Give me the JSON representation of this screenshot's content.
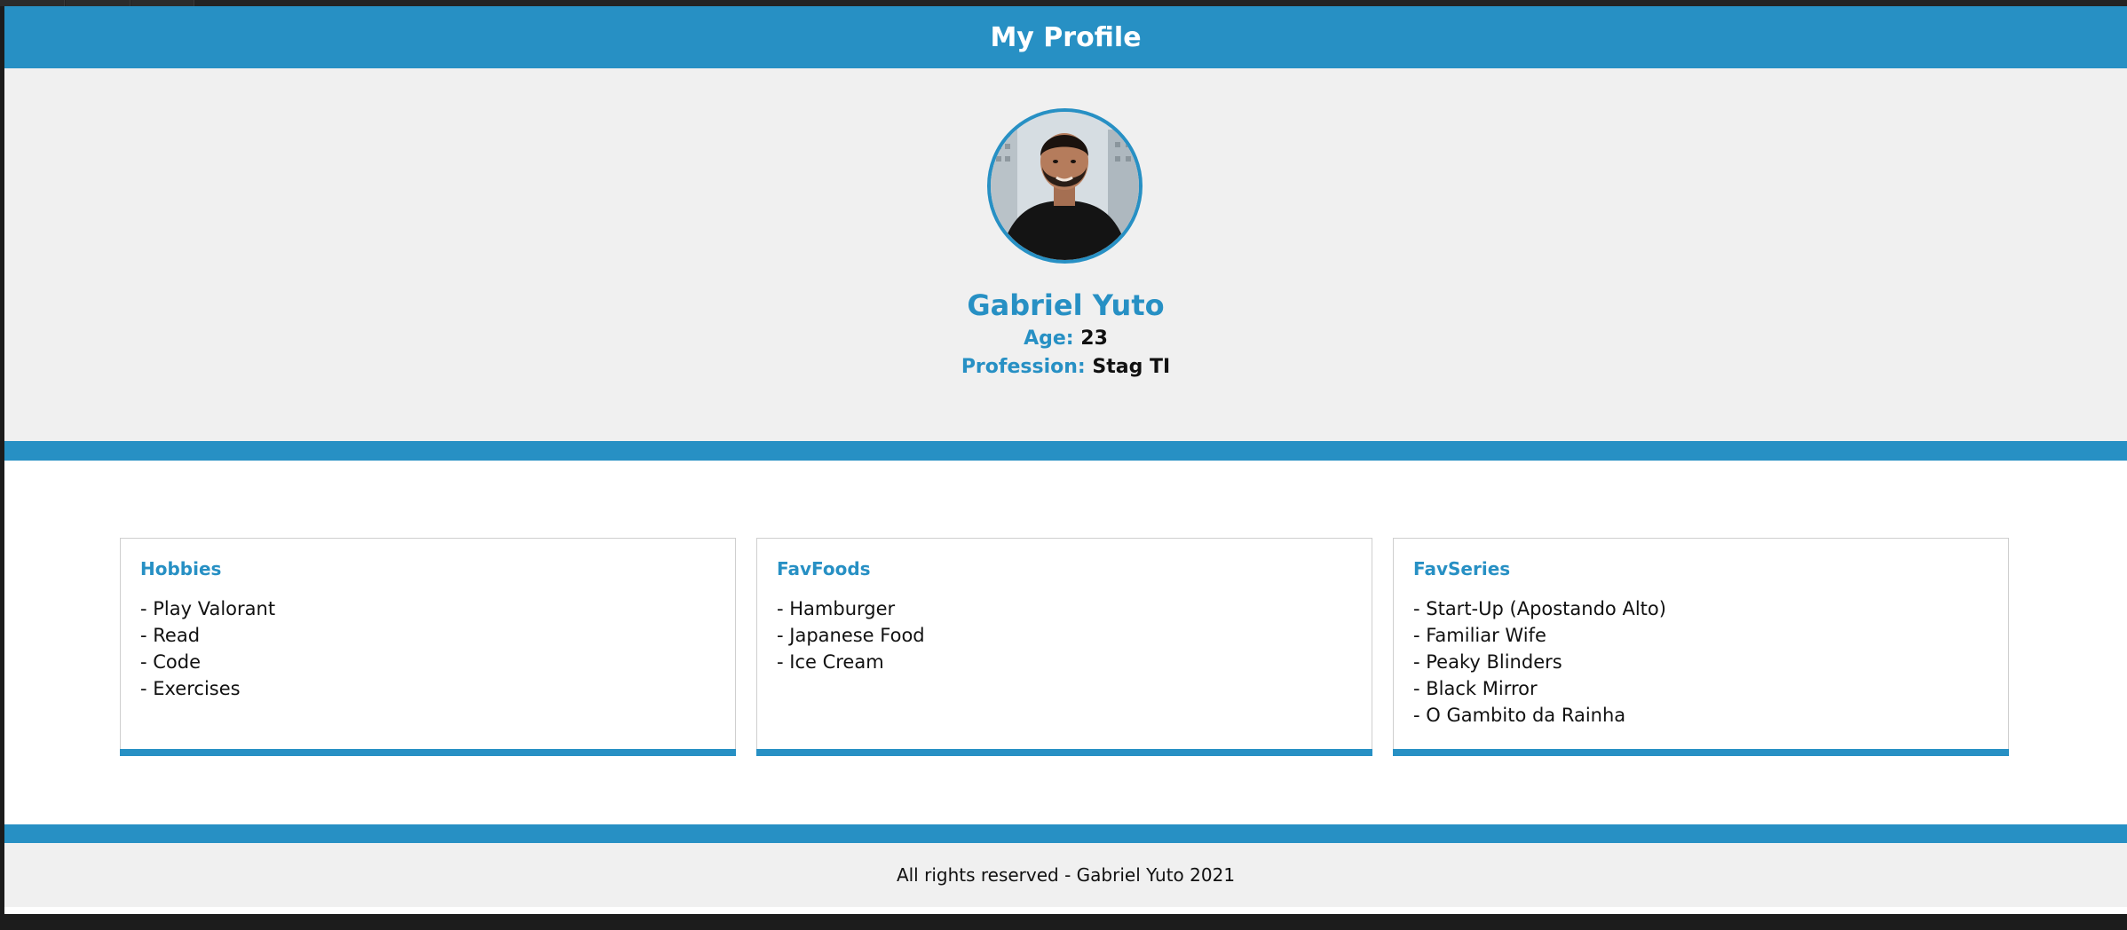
{
  "header": {
    "title": "My Profile"
  },
  "profile": {
    "name": "Gabriel Yuto",
    "age_label": "Age:",
    "age_value": "23",
    "profession_label": "Profession:",
    "profession_value": "Stag TI"
  },
  "cards": [
    {
      "title": "Hobbies",
      "items": [
        "- Play Valorant",
        "- Read",
        "- Code",
        "- Exercises"
      ]
    },
    {
      "title": "FavFoods",
      "items": [
        "- Hamburger",
        "- Japanese Food",
        "- Ice Cream"
      ]
    },
    {
      "title": "FavSeries",
      "items": [
        "- Start-Up (Apostando Alto)",
        "- Familiar Wife",
        "- Peaky Blinders",
        "- Black Mirror",
        "- O Gambito da Rainha"
      ]
    }
  ],
  "footer": {
    "text": "All rights reserved - Gabriel Yuto 2021"
  },
  "colors": {
    "accent": "#2790c4",
    "section_bg": "#f0f0f0",
    "text": "#111111"
  }
}
